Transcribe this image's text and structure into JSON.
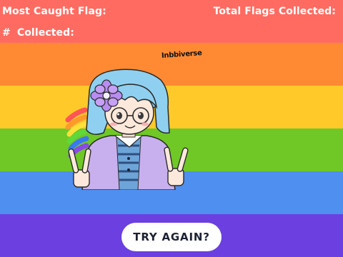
{
  "hud": {
    "most_caught_label": "Most Caught Flag:",
    "collected_label": "Collected:",
    "collected_prefix": "#",
    "total_flags_label": "Total Flags Collected:"
  },
  "artwork": {
    "signature": "Inbbiverse",
    "character_icon": "character-illustration",
    "flower_icon": "flower-icon"
  },
  "button": {
    "label": "TRY AGAIN?"
  },
  "colors": {
    "stripes": [
      "#ff6b61",
      "#ff8a33",
      "#ffc92a",
      "#6fc826",
      "#4f8ff0",
      "#6b3fe0"
    ],
    "hair": "#8fd0f0",
    "flower": "#b88cf0",
    "jacket": "#c8b0ee"
  }
}
